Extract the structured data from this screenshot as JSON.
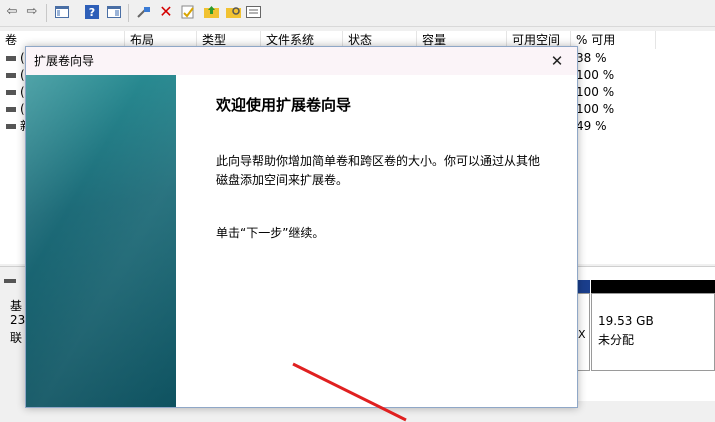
{
  "toolbar": {
    "icons": [
      "back-arrow-icon",
      "forward-arrow-icon",
      "console-tree-icon",
      "help-icon",
      "show-hide-icon",
      "connect-icon",
      "delete-icon",
      "properties-icon",
      "up-folder-icon",
      "open-folder-icon",
      "export-list-icon"
    ],
    "colors": {
      "delete": "#d40000"
    }
  },
  "table": {
    "columns": [
      "卷",
      "布局",
      "类型",
      "文件系统",
      "状态",
      "容量",
      "可用空间",
      "% 可用"
    ],
    "rows": [
      {
        "volume": "(",
        "percent": "38 %"
      },
      {
        "volume": "(",
        "percent": "100 %"
      },
      {
        "volume": "(",
        "percent": "100 %"
      },
      {
        "volume": "(",
        "percent": "100 %"
      },
      {
        "volume": "新",
        "percent": "49 %"
      }
    ]
  },
  "disk": {
    "label_line1": "基",
    "label_line2": "23",
    "label_line3": "联",
    "partition_size": "19.53 GB",
    "partition_status": "未分配",
    "small_mark": "X",
    "colors": {
      "primary_bar": "#1a3e8c",
      "unallocated_bar": "#000000"
    }
  },
  "dialog": {
    "title": "扩展卷向导",
    "close_label": "✕",
    "heading": "欢迎使用扩展卷向导",
    "paragraph": "此向导帮助你增加简单卷和跨区卷的大小。你可以通过从其他磁盘添加空间来扩展卷。",
    "instruction": "单击“下一步”继续。",
    "sidebar_color": "#1d6b78",
    "annotation_color": "#e02020"
  }
}
